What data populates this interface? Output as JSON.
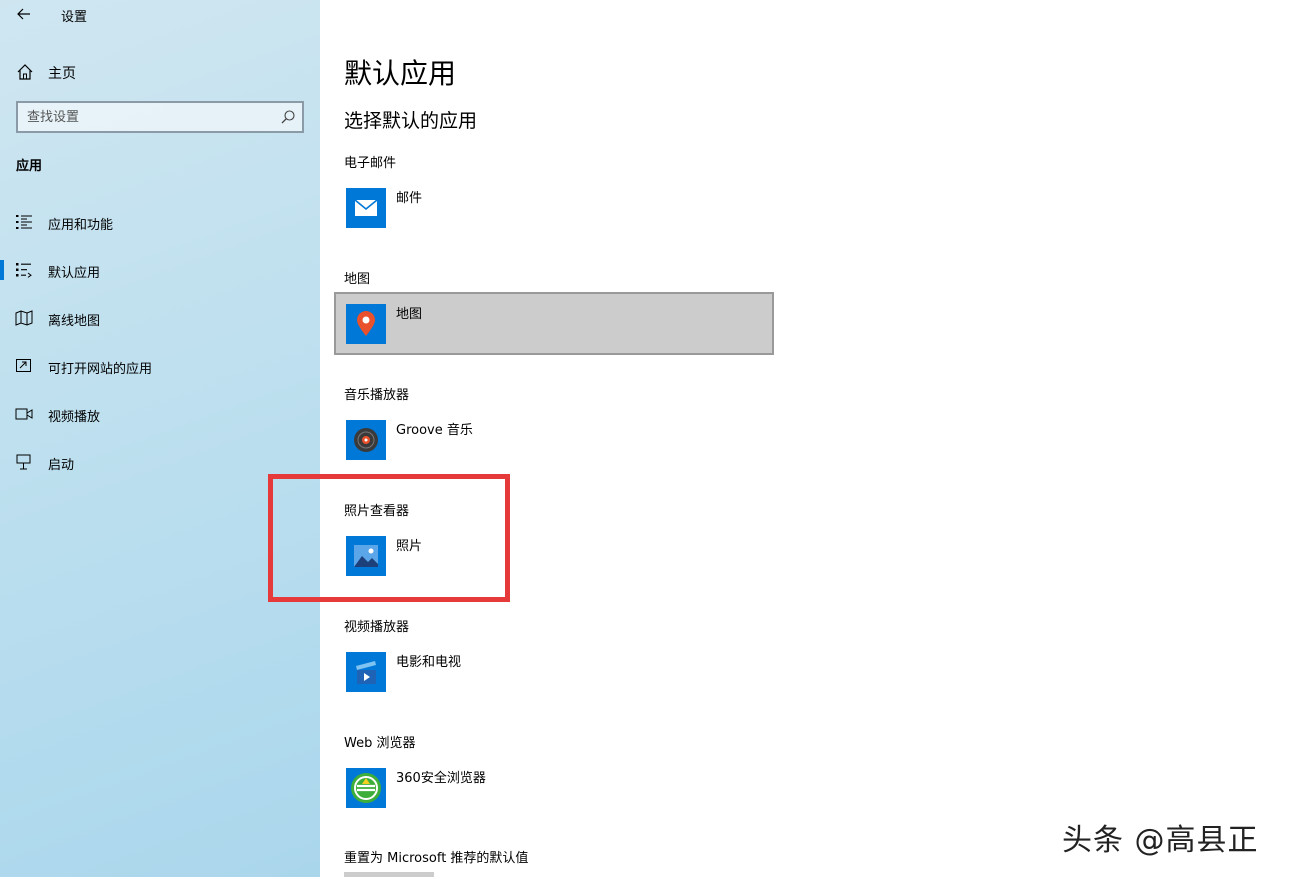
{
  "window": {
    "title": "设置"
  },
  "sidebar": {
    "home_label": "主页",
    "search_placeholder": "查找设置",
    "section_title": "应用",
    "items": [
      {
        "label": "应用和功能",
        "icon": "list-icon",
        "selected": false
      },
      {
        "label": "默认应用",
        "icon": "default-apps-icon",
        "selected": true
      },
      {
        "label": "离线地图",
        "icon": "offline-map-icon",
        "selected": false
      },
      {
        "label": "可打开网站的应用",
        "icon": "open-in-app-icon",
        "selected": false
      },
      {
        "label": "视频播放",
        "icon": "video-icon",
        "selected": false
      },
      {
        "label": "启动",
        "icon": "startup-icon",
        "selected": false
      }
    ]
  },
  "main": {
    "title": "默认应用",
    "subtitle": "选择默认的应用",
    "categories": [
      {
        "label": "电子邮件",
        "app": "邮件",
        "icon": "mail-icon"
      },
      {
        "label": "地图",
        "app": "地图",
        "icon": "maps-icon"
      },
      {
        "label": "音乐播放器",
        "app": "Groove 音乐",
        "icon": "groove-icon"
      },
      {
        "label": "照片查看器",
        "app": "照片",
        "icon": "photos-icon"
      },
      {
        "label": "视频播放器",
        "app": "电影和电视",
        "icon": "movies-tv-icon"
      },
      {
        "label": "Web 浏览器",
        "app": "360安全浏览器",
        "icon": "browser-360-icon"
      }
    ],
    "reset_label": "重置为 Microsoft 推荐的默认值"
  },
  "watermark": "头条 @高县正",
  "colors": {
    "accent": "#0078d7",
    "highlight": "#e5393a",
    "tile_blue": "#0078d7"
  }
}
